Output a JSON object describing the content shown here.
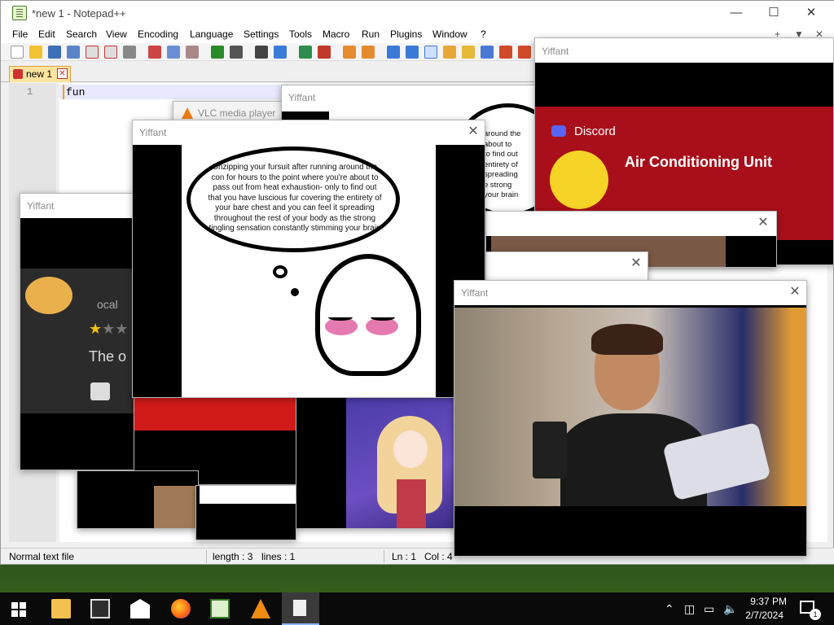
{
  "notepad": {
    "title": "*new 1 - Notepad++",
    "menu": [
      "File",
      "Edit",
      "Search",
      "View",
      "Encoding",
      "Language",
      "Settings",
      "Tools",
      "Macro",
      "Run",
      "Plugins",
      "Window",
      "?"
    ],
    "menu_right": [
      "+",
      "▼",
      "✕"
    ],
    "tab_label": "new 1",
    "line_number": "1",
    "content": "fun",
    "status": {
      "file_type": "Normal text file",
      "length": "length : 3",
      "lines": "lines : 1",
      "ln": "Ln : 1",
      "col": "Col : 4"
    }
  },
  "vlc": {
    "title": "VLC media player"
  },
  "popups": {
    "title": "Yiffant",
    "thought_text": "Unzipping your fursuit after running around the con for hours to the point where you're about to pass out from heat exhaustion- only to find out that you have luscious fur covering the entirety of your bare chest and you can feel it spreading throughout the rest of your body as the strong tingling sensation constantly stimming your brain",
    "partial_text_lines": [
      "around the",
      "about to",
      "to find out",
      "entirety of",
      "spreading",
      "e strong",
      "your brain"
    ],
    "review_text": "The o",
    "review_partial": "ocal"
  },
  "discord": {
    "label": "Discord",
    "server_name": "Air Conditioning Unit"
  },
  "taskbar": {
    "time": "9:37 PM",
    "date": "2/7/2024",
    "notification_count": "1"
  },
  "colors": {
    "accent": "#ffe4a0",
    "discord_red": "#a90f1a",
    "taskbar": "#0a0a0a"
  }
}
